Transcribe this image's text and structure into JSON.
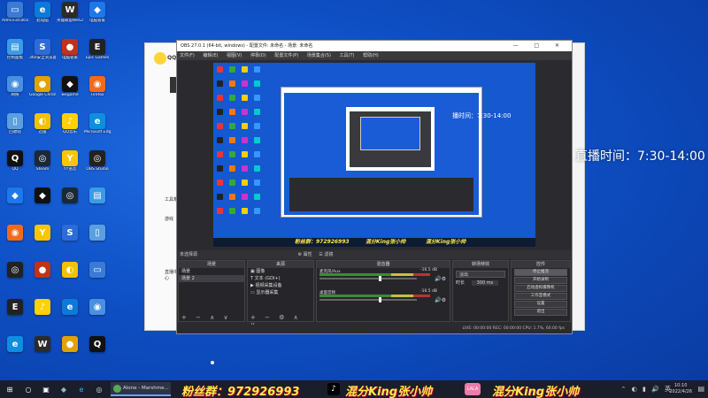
{
  "desktop": {
    "icons": [
      {
        "label": "Administrator",
        "color": "#3a7bd5",
        "glyph": "▭"
      },
      {
        "label": "此电脑",
        "color": "#0c7ad9",
        "glyph": "e"
      },
      {
        "label": "英雄联盟WeGame",
        "color": "#2b2b2b",
        "glyph": "W"
      },
      {
        "label": "电脑管家",
        "color": "#1d78ea",
        "glyph": "◆"
      },
      {
        "label": "控制面板",
        "color": "#3a9be8",
        "glyph": "▤"
      },
      {
        "label": "360安全浏览器",
        "color": "#2d6cd8",
        "glyph": "S"
      },
      {
        "label": "电脑管家",
        "color": "#c3311b",
        "glyph": "●"
      },
      {
        "label": "Epic Games",
        "color": "#222",
        "glyph": "E"
      },
      {
        "label": "网络",
        "color": "#4a8fe0",
        "glyph": "◉"
      },
      {
        "label": "Google Chrome",
        "color": "#e0a400",
        "glyph": "●"
      },
      {
        "label": "wegame",
        "color": "#111",
        "glyph": "◆"
      },
      {
        "label": "Firefox",
        "color": "#f26a1b",
        "glyph": "◉"
      },
      {
        "label": "回收站",
        "color": "#5aa0e0",
        "glyph": "▯"
      },
      {
        "label": "迅雷",
        "color": "#f2c200",
        "glyph": "◐"
      },
      {
        "label": "QQ音乐",
        "color": "#ffd100",
        "glyph": "♪"
      },
      {
        "label": "Microsoft Edge",
        "color": "#0e8ee0",
        "glyph": "e"
      },
      {
        "label": "QQ",
        "color": "#111",
        "glyph": "Q"
      },
      {
        "label": "Steam",
        "color": "#1b2838",
        "glyph": "◎"
      },
      {
        "label": "YY语音",
        "color": "#fbc500",
        "glyph": "Y"
      },
      {
        "label": "OBS Studio",
        "color": "#222",
        "glyph": "◎"
      }
    ]
  },
  "bg_window": {
    "app_label": "QQ",
    "side_items": [
      "工具箱",
      "游戏",
      "直播中心"
    ],
    "stream_time": "直播时间：7:30-14:00"
  },
  "obs": {
    "title": "OBS 27.0.1 (64-bit, windows) - 配置文件: 未命名 - 场景: 未命名",
    "menu": [
      "文件(F)",
      "编辑(E)",
      "视图(V)",
      "停靠(D)",
      "配置文件(P)",
      "场景集合(S)",
      "工具(T)",
      "帮助(H)"
    ],
    "preview": {
      "stream_time": "播时间：7:30-14:00",
      "fans_banner": "粉丝群：972926993",
      "mix_banner_1": "混分King张小帅",
      "mix_banner_2": "混分King张小帅"
    },
    "scene_bar": {
      "label": "未选择源",
      "props": "⚙ 属性",
      "filters": "☰ 滤镜"
    },
    "docks": {
      "scenes": {
        "header": "场景",
        "items": [
          "场景",
          "场景 2"
        ]
      },
      "sources": {
        "header": "来源",
        "items": [
          "图像",
          "文本 (GDI+)",
          "视频采集设备",
          "显示器采集"
        ]
      },
      "mixer": {
        "header": "混音器",
        "channels": [
          {
            "name": "麦克风/Aux",
            "db": "-16.5 dB"
          },
          {
            "name": "桌面音频",
            "db": "-16.5 dB"
          }
        ]
      },
      "transitions": {
        "header": "转场特效",
        "type": "淡出",
        "duration_label": "时长",
        "duration": "300 ms"
      },
      "controls": {
        "header": "控件",
        "buttons": [
          "停止推流",
          "开始录制",
          "启动虚拟摄像机",
          "工作室模式",
          "设置",
          "退出"
        ]
      }
    },
    "status": "LIVE: 00:00:00   REC: 00:00:00   CPU: 1.7%, 60.00 fps"
  },
  "taskbar": {
    "app": "Alone - Marshme...",
    "fans": "粉丝群：972926993",
    "mix_1": "混分King张小帅",
    "mix_2": "混分King张小帅",
    "pink_label": "LALA",
    "time": "10:10",
    "date": "2022/4/26"
  }
}
